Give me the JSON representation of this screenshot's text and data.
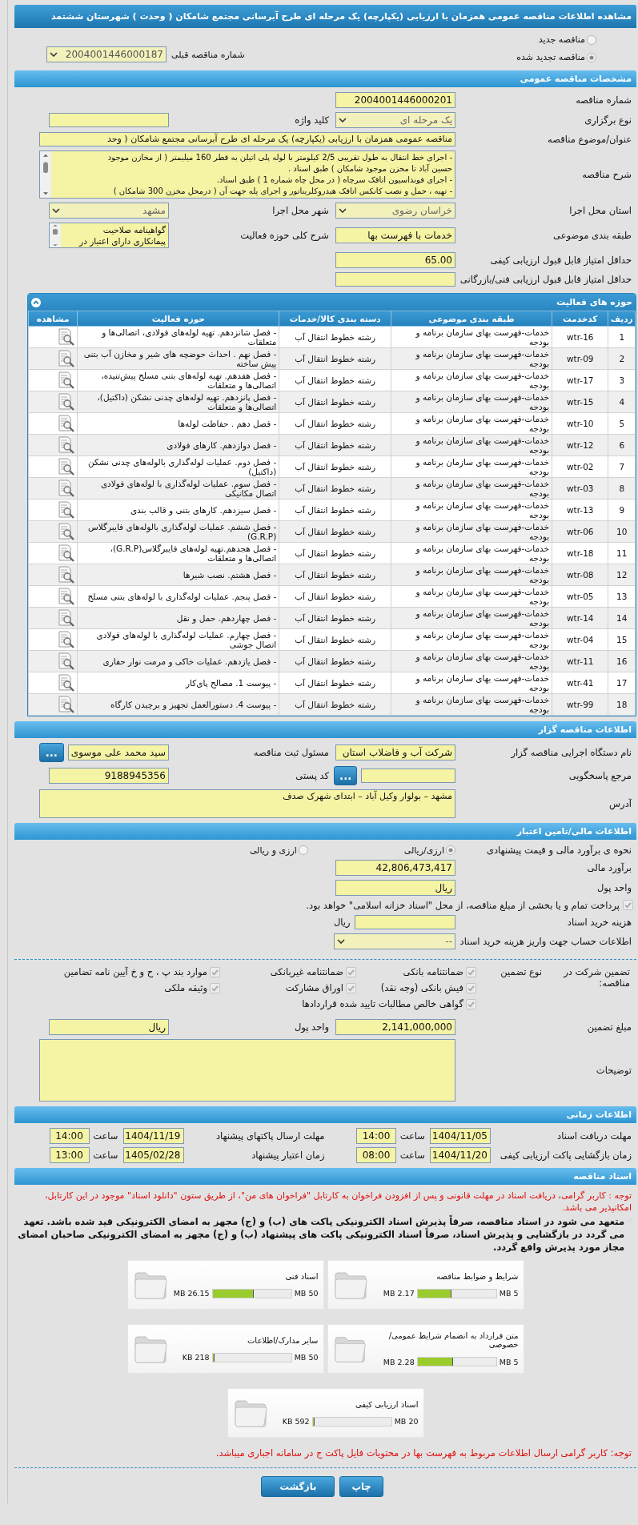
{
  "page_title": "مشاهده اطلاعات مناقصه عمومی همزمان با ارزیابی (یکپارچه) یک مرحله ای طرح آبرسانی مجتمع شامکان ( وحدت ) شهرستان ششتمد",
  "tender_kind": {
    "options": [
      {
        "label": "مناقصه جدید",
        "selected": false
      },
      {
        "label": "مناقصه تجدید شده",
        "selected": true
      }
    ],
    "previous_label": "شماره مناقصه قبلی",
    "previous_value": "2004001446000187"
  },
  "general": {
    "title": "مشخصات مناقصه عمومی",
    "rows": [
      [
        {
          "label": "شماره مناقصه",
          "kind": "input",
          "value": "2004001446000201"
        }
      ],
      [
        {
          "label": "نوع برگزاری",
          "kind": "select",
          "value": "یک مرحله ای"
        },
        {
          "label": "کلید واژه",
          "kind": "input"
        }
      ],
      [
        {
          "label": "عنوان/موضوع مناقصه",
          "kind": "long-input",
          "value": "مناقصه عمومی همزمان با ارزیابی (یکپارچه) یک مرحله ای طرح آبرسانی مجتمع شامکان ( وحد"
        }
      ],
      [
        {
          "label": "شرح مناقصه",
          "kind": "textarea",
          "lines": [
            "- اجرای خط انتقال به طول تقریبی 2/5 کیلومتر با لوله پلی اتیلن به قطر 160 میلیمتر ( از مخازن موجود",
            "حسین آباد  تا مخزن موجود شامکان )  طبق اسناد .",
            "- اجرای فونداسیون اتاقک سرچاه  ( در محل  چاه شماره 1 )  طبق اسناد.",
            "- تهیه ، حمل و نصب کانکس اتاقک هیدروکلریناتور  و اجرای پله جهت آن ( درمحل مخزن 300 شامکان )"
          ]
        }
      ],
      [
        {
          "label": "استان محل اجرا",
          "kind": "select",
          "value": "خراسان رضوی"
        },
        {
          "label": "شهر محل اجرا",
          "kind": "select",
          "value": "مشهد"
        }
      ],
      [
        {
          "label": "طبقه بندی موضوعی",
          "kind": "input",
          "value": "خدمات با فهرست بها"
        },
        {
          "label": "شرح کلی حوزه فعالیت",
          "kind": "list-box",
          "lines": [
            "گواهینامه صلاحیت",
            "پیمانکاری دارای اعتبار در"
          ]
        }
      ],
      [
        {
          "label": "حداقل امتیاز قابل قبول ارزیابی کیفی",
          "kind": "input",
          "value": "65.00"
        }
      ],
      [
        {
          "label": "حداقل امتیاز قابل قبول ارزیابی فنی/بازرگانی",
          "kind": "input"
        }
      ]
    ]
  },
  "activities": {
    "title": "حوزه های فعالیت",
    "columns": [
      "ردیف",
      "کدخدمت",
      "طبقه بندی موضوعی",
      "دسته بندی کالا/خدمات",
      "حوزه فعالیت",
      "مشاهده"
    ],
    "rows": [
      {
        "index": "1",
        "code": "wtr-16",
        "subject": "خدمات-فهرست بهای سازمان برنامه و بودجه",
        "category": "رشته خطوط انتقال آب",
        "activity": "- فصل شانزدهم. تهیه لوله‌های فولادی، اتصالی‌ها و متعلقات"
      },
      {
        "index": "2",
        "code": "wtr-09",
        "subject": "خدمات-فهرست بهای سازمان برنامه و بودجه",
        "category": "رشته خطوط انتقال آب",
        "activity": "- فصل نهم . احداث حوضچه های شیر و مخازن آب بتنی پیش ساخته"
      },
      {
        "index": "3",
        "code": "wtr-17",
        "subject": "خدمات-فهرست بهای سازمان برنامه و بودجه",
        "category": "رشته خطوط انتقال آب",
        "activity": "- فصل هفدهم. تهیه لوله‌های بتنی مسلح پیش‌تنیده، اتصالی‌ها و متعلقات"
      },
      {
        "index": "4",
        "code": "wtr-15",
        "subject": "خدمات-فهرست بهای سازمان برنامه و بودجه",
        "category": "رشته خطوط انتقال آب",
        "activity": "- فصل پانزدهم. تهیه لوله‌های چدنی نشکن (داکتیل)، اتصالی‌ها و متعلقات"
      },
      {
        "index": "5",
        "code": "wtr-10",
        "subject": "خدمات-فهرست بهای سازمان برنامه و بودجه",
        "category": "رشته خطوط انتقال آب",
        "activity": "- فصل دهم . حفاظت لوله‌ها"
      },
      {
        "index": "6",
        "code": "wtr-12",
        "subject": "خدمات-فهرست بهای سازمان برنامه و بودجه",
        "category": "رشته خطوط انتقال آب",
        "activity": "- فصل دوازدهم. کارهای فولادی"
      },
      {
        "index": "7",
        "code": "wtr-02",
        "subject": "خدمات-فهرست بهای سازمان برنامه و بودجه",
        "category": "رشته خطوط انتقال آب",
        "activity": "- فصل دوم. عملیات لوله‌گذاری بالوله‌های چدنی نشکن (داکتیل)"
      },
      {
        "index": "8",
        "code": "wtr-03",
        "subject": "خدمات-فهرست بهای سازمان برنامه و بودجه",
        "category": "رشته خطوط انتقال آب",
        "activity": "- فصل سوم. عملیات لوله‌گذاری با لوله‌های فولادی اتصال مکانیکی"
      },
      {
        "index": "9",
        "code": "wtr-13",
        "subject": "خدمات-فهرست بهای سازمان برنامه و بودجه",
        "category": "رشته خطوط انتقال آب",
        "activity": "- فصل سیزدهم. کارهای بتنی و قالب بندی"
      },
      {
        "index": "10",
        "code": "wtr-06",
        "subject": "خدمات-فهرست بهای سازمان برنامه و بودجه",
        "category": "رشته خطوط انتقال آب",
        "activity": "- فصل ششم. عملیات لوله‌گذاری بالوله‌های فایبرگلاس (G.R.P)"
      },
      {
        "index": "11",
        "code": "wtr-18",
        "subject": "خدمات-فهرست بهای سازمان برنامه و بودجه",
        "category": "رشته خطوط انتقال آب",
        "activity": "- فصل هجدهم.تهیه لوله‌های فایبرگلاس(G.R.P)، اتصالی‌ها و متعلقات"
      },
      {
        "index": "12",
        "code": "wtr-08",
        "subject": "خدمات-فهرست بهای سازمان برنامه و بودجه",
        "category": "رشته خطوط انتقال آب",
        "activity": "- فصل هشتم. نصب شیرها"
      },
      {
        "index": "13",
        "code": "wtr-05",
        "subject": "خدمات-فهرست بهای سازمان برنامه و بودجه",
        "category": "رشته خطوط انتقال آب",
        "activity": "- فصل پنجم. عملیات لوله‌گذاری با لوله‌های بتنی مسلح"
      },
      {
        "index": "14",
        "code": "wtr-14",
        "subject": "خدمات-فهرست بهای سازمان برنامه و بودجه",
        "category": "رشته خطوط انتقال آب",
        "activity": "- فصل چهاردهم. حمل و نقل"
      },
      {
        "index": "15",
        "code": "wtr-04",
        "subject": "خدمات-فهرست بهای سازمان برنامه و بودجه",
        "category": "رشته خطوط انتقال آب",
        "activity": "- فصل چهارم. عملیات لوله‌گذاری با لوله‌های فولادی اتصال جوشی"
      },
      {
        "index": "16",
        "code": "wtr-11",
        "subject": "خدمات-فهرست بهای سازمان برنامه و بودجه",
        "category": "رشته خطوط انتقال آب",
        "activity": "- فصل یازدهم. عملیات خاکی و مرمت نوار حفاری"
      },
      {
        "index": "17",
        "code": "wtr-41",
        "subject": "خدمات-فهرست بهای سازمان برنامه و بودجه",
        "category": "رشته خطوط انتقال آب",
        "activity": "- پیوست 1. مصالح پای‌کار"
      },
      {
        "index": "18",
        "code": "wtr-99",
        "subject": "خدمات-فهرست بهای سازمان برنامه و بودجه",
        "category": "رشته خطوط انتقال آب",
        "activity": "- پیوست 4. دستورالعمل تجهیز و برچیدن کارگاه"
      }
    ]
  },
  "tenderer": {
    "title": "اطلاعات مناقصه گزار",
    "rows": [
      [
        {
          "label": "نام دستگاه اجرایی مناقصه گزار",
          "kind": "input",
          "value": "شرکت آب و فاضلاب استان"
        },
        {
          "label": "مسئول ثبت مناقصه",
          "kind": "input",
          "value": "سید محمد علی موسوی",
          "button": "..."
        }
      ],
      [
        {
          "label": "مرجع پاسخگویی",
          "kind": "input",
          "button": "..."
        },
        {
          "label": "کد پستی",
          "kind": "input",
          "value": "9188945356"
        }
      ],
      [
        {
          "label": "آدرس",
          "kind": "memo",
          "lines": [
            "مشهد – بولوار وکیل آباد – ابتدای شهرک صدف"
          ]
        }
      ]
    ]
  },
  "finance": {
    "title": "اطلاعات مالی/تامین اعتبار",
    "method_label": "نحوه ی برآورد مالی و قیمت پیشنهادی",
    "method_options": [
      {
        "label": "ارزی/ریالی",
        "selected": true
      },
      {
        "label": "ارزی و ریالی",
        "selected": false
      }
    ],
    "rows": [
      [
        {
          "label": "برآورد مالی",
          "kind": "input",
          "value": "42,806,473,417"
        }
      ],
      [
        {
          "label": "واحد پول",
          "kind": "input",
          "value": "ریال"
        }
      ]
    ],
    "treasury": {
      "checked": true,
      "text": "پرداخت تمام و یا بخشی از مبلغ مناقصه، از محل \"اسناد خزانه اسلامی\" خواهد بود."
    },
    "fee": {
      "label": "هزینه خرید اسناد",
      "unit": "ریال"
    },
    "account": {
      "label": "اطلاعات حساب جهت واریز هزینه خرید اسناد",
      "value": "--"
    }
  },
  "guarantee": {
    "title": "تضمین شرکت در مناقصه:",
    "type_label": "نوع تضمین",
    "options": [
      {
        "label": "ضمانتنامه بانکی",
        "checked": true
      },
      {
        "label": "ضمانتنامه غیربانکی",
        "checked": true
      },
      {
        "label": "موارد بند پ ، ح و خ آیین نامه تضامین",
        "checked": true
      },
      {
        "label": "فیش بانکی (وجه نقد)",
        "checked": true
      },
      {
        "label": "اوراق مشارکت",
        "checked": true
      },
      {
        "label": "وثیقه ملکی",
        "checked": true
      },
      {
        "label": "گواهی خالص مطالبات تایید شده قراردادها",
        "checked": true
      }
    ],
    "rows": [
      [
        {
          "label": "مبلغ تضمین",
          "kind": "input",
          "value": "2,141,000,000"
        },
        {
          "label": "واحد پول",
          "kind": "input",
          "value": "ریال"
        }
      ],
      [
        {
          "label": "توضیحات",
          "kind": "memo"
        }
      ]
    ]
  },
  "schedule": {
    "title": "اطلاعات زمانی",
    "items": [
      {
        "label": "مهلت دریافت اسناد",
        "date": "1404/11/05",
        "time_label": "ساعت",
        "time": "14:00"
      },
      {
        "label": "مهلت ارسال پاکتهای پیشنهاد",
        "date": "1404/11/19",
        "time_label": "ساعت",
        "time": "14:00"
      },
      {
        "label": "زمان بازگشایی پاکت ارزیابی کیفی",
        "date": "1404/11/20",
        "time_label": "ساعت",
        "time": "08:00"
      },
      {
        "label": "زمان اعتبار پیشنهاد",
        "date": "1405/02/28",
        "time_label": "ساعت",
        "time": "13:00"
      }
    ]
  },
  "documents": {
    "title": "اسناد مناقصه",
    "notice": "توجه : کاربر گرامی، دریافت اسناد در مهلت قانونی و پس از افزودن فراخوان به کارتابل \"فراخوان های من\"، از طریق ستون \"دانلود اسناد\" موجود در این کارتابل، امکانپذیر می باشد.",
    "commitment": {
      "checked": true,
      "text": "متعهد می شود در اسناد مناقصه، صرفاً پذیرش اسناد الکترونیکی پاکت های (ب) و (ج) مجهز به امضای الکترونیکی قید شده باشد. تعهد می گردد در بازگشایی و پذیرش اسناد، صرفاً اسناد الکترونیکی پاکت های پیشنهاد (ب) و (ج) مجهز به امضای الکترونیکی صاحبان امضای مجاز مورد پذیرش واقع گردد."
    },
    "files": [
      {
        "name": "شرایط و ضوابط مناقصه",
        "size": "2.17 MB",
        "limit": "5 MB",
        "level": 0.434
      },
      {
        "name": "اسناد فنی",
        "size": "26.15 MB",
        "limit": "50 MB",
        "level": 0.523
      },
      {
        "name": "متن قرارداد به انضمام شرایط عمومی/خصوصی",
        "size": "2.28 MB",
        "limit": "5 MB",
        "level": 0.456
      },
      {
        "name": "سایر مدارک/اطلاعات",
        "size": "218 KB",
        "limit": "50 MB",
        "level": 0.004
      },
      {
        "name": "اسناد ارزیابی کیفی",
        "size": "592 KB",
        "limit": "20 MB",
        "level": 0.029
      }
    ],
    "note": "توجه: کاربر گرامی ارسال اطلاعات مربوط به فهرست بها در محتویات فایل پاکت ج در سامانه اجباری میباشد."
  },
  "buttons": [
    {
      "label": "چاپ"
    },
    {
      "label": "بازگشت"
    }
  ]
}
